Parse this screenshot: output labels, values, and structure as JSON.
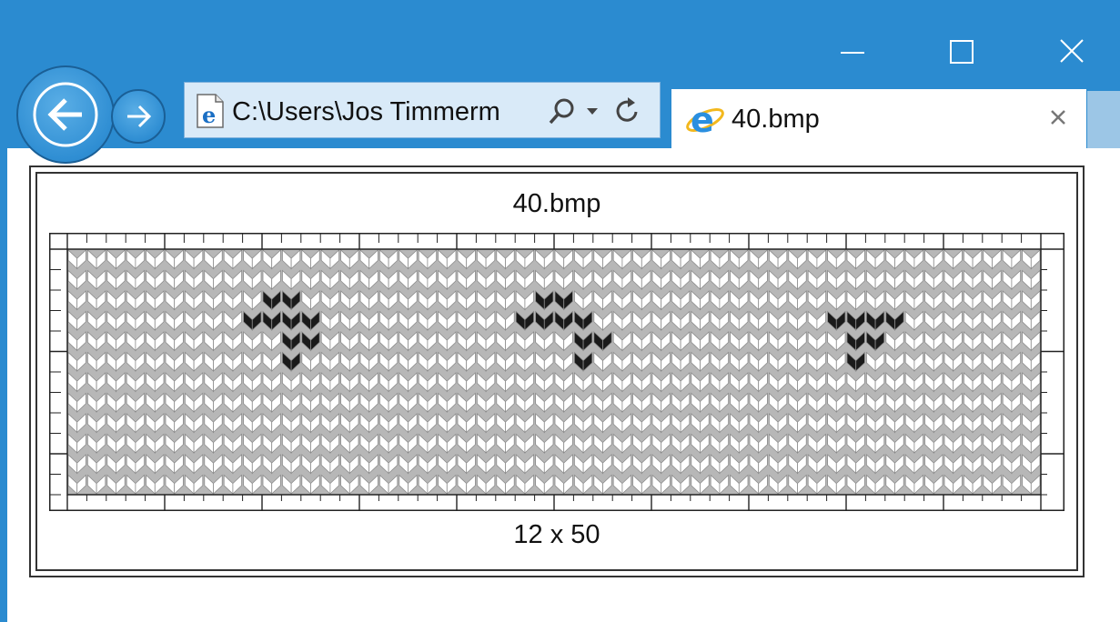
{
  "window": {
    "minimize_label": "Minimize",
    "maximize_label": "Maximize",
    "close_label": "Close",
    "accent_color": "#2b8bd0"
  },
  "address_bar": {
    "value": "C:\\Users\\Jos Timmerm",
    "icon": "ie-document-icon",
    "search_icon": "search-icon",
    "dropdown_icon": "chevron-down-icon",
    "refresh_icon": "refresh-icon"
  },
  "tab": {
    "title": "40.bmp",
    "icon": "ie-logo-icon",
    "close_icon": "close-icon"
  },
  "content": {
    "title": "40.bmp",
    "dimensions_label": "12 x 50"
  },
  "chart_data": {
    "type": "heatmap",
    "rows": 12,
    "cols": 50,
    "stitch_colors": {
      "0": "#ffffff",
      "1": "#1a1a1a"
    },
    "grid": [
      "00000000000000000000000000000000000000000000000000",
      "00000000000000000000000000000000000000000000000000",
      "00000000001100000000000011000000000000000000000000",
      "00000000011110000000000111100000000000011110000000",
      "00000000000110000000000000110000000000001100000000",
      "00000000000100000000000000100000000000001000000000",
      "00000000000000000000000000000000000000000000000000",
      "00000000000000000000000000000000000000000000000000",
      "00000000000000000000000000000000000000000000000000",
      "00000000000000000000000000000000000000000000000000",
      "00000000000000000000000000000000000000000000000000",
      "00000000000000000000000000000000000000000000000000"
    ]
  }
}
